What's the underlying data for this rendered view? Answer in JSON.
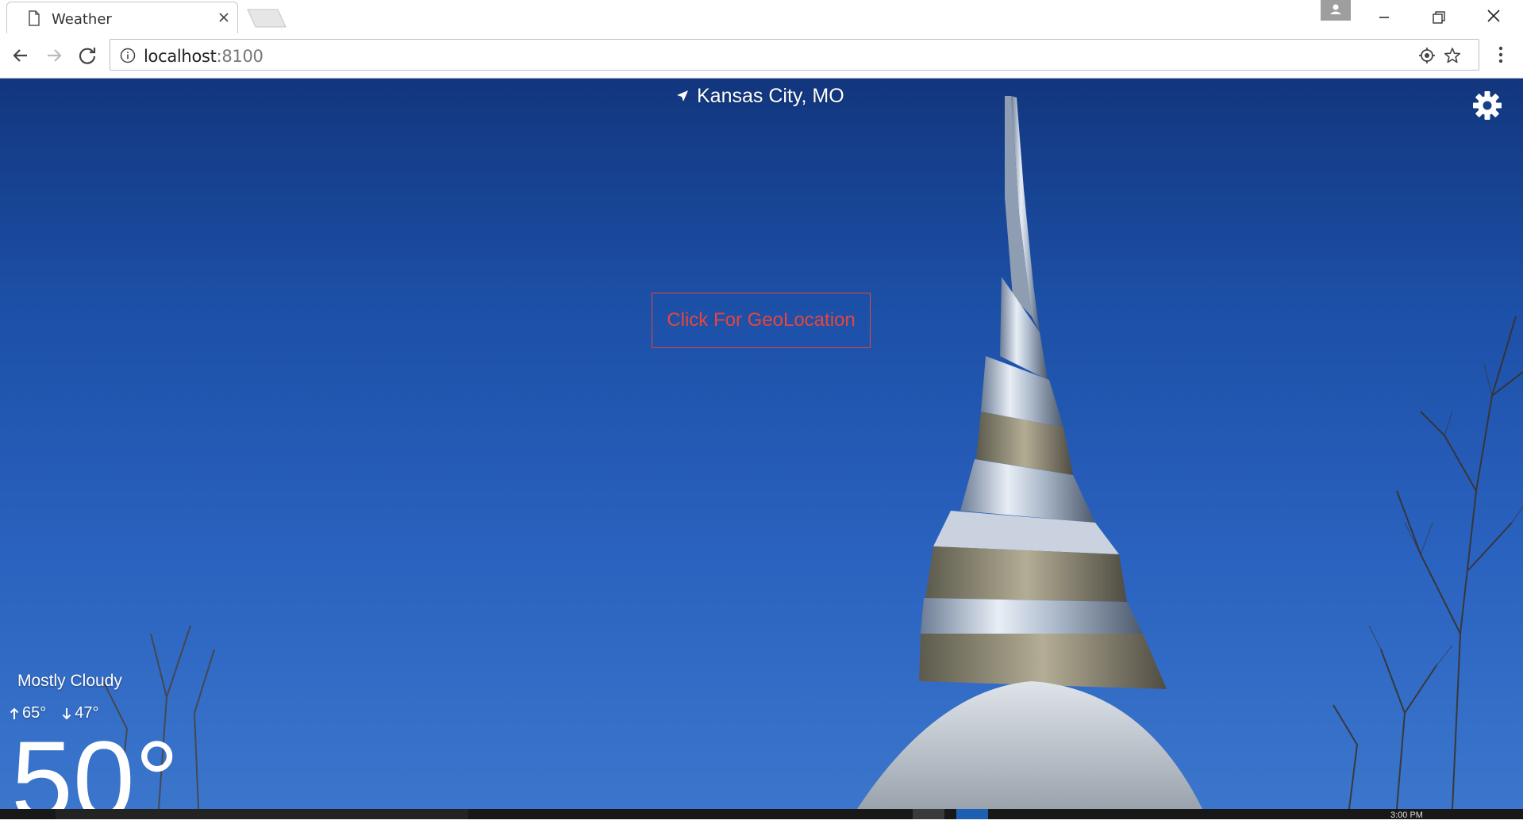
{
  "browser": {
    "tab_title": "Weather",
    "url_host": "localhost",
    "url_port": ":8100"
  },
  "app": {
    "location": "Kansas City, MO",
    "geo_button_label": "Click For GeoLocation",
    "condition": "Mostly Cloudy",
    "high": "65°",
    "low": "47°",
    "temperature": "50°"
  },
  "taskbar": {
    "clock": "3:00 PM"
  },
  "colors": {
    "accent_button": "#e8453c",
    "sky_top": "#12367e",
    "sky_bottom": "#3b76cc"
  },
  "icons": {
    "tab": "page-icon",
    "location": "navigation-arrow-icon",
    "settings": "gear-icon"
  }
}
